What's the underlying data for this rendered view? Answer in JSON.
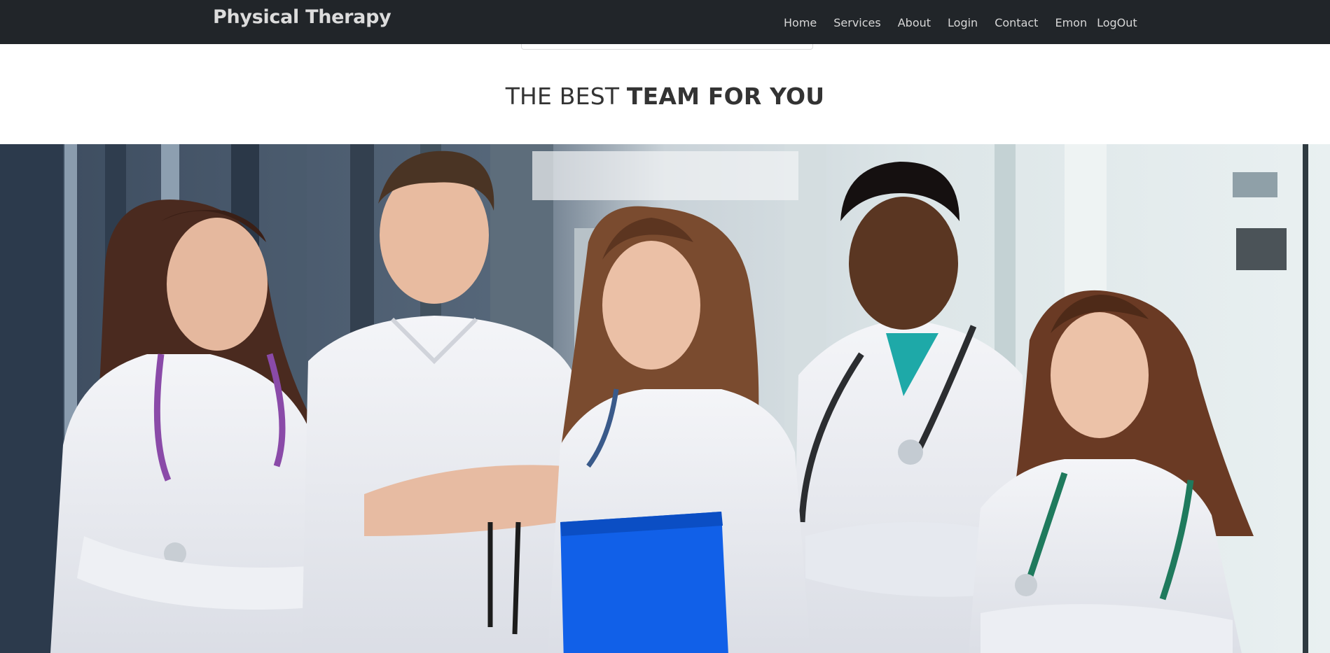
{
  "navbar": {
    "brand": "Physical Therapy",
    "links": [
      {
        "label": "Home"
      },
      {
        "label": "Services"
      },
      {
        "label": "About"
      },
      {
        "label": "Login"
      },
      {
        "label": "Contact"
      }
    ],
    "user_name": "Emon",
    "logout_label": "LogOut"
  },
  "section": {
    "heading_light": "THE BEST",
    "heading_bold": "TEAM FOR YOU"
  },
  "colors": {
    "navbar_bg": "#212529",
    "nav_text": "#d7d7d7",
    "heading_text": "#333333",
    "folder_blue": "#1160e8"
  }
}
